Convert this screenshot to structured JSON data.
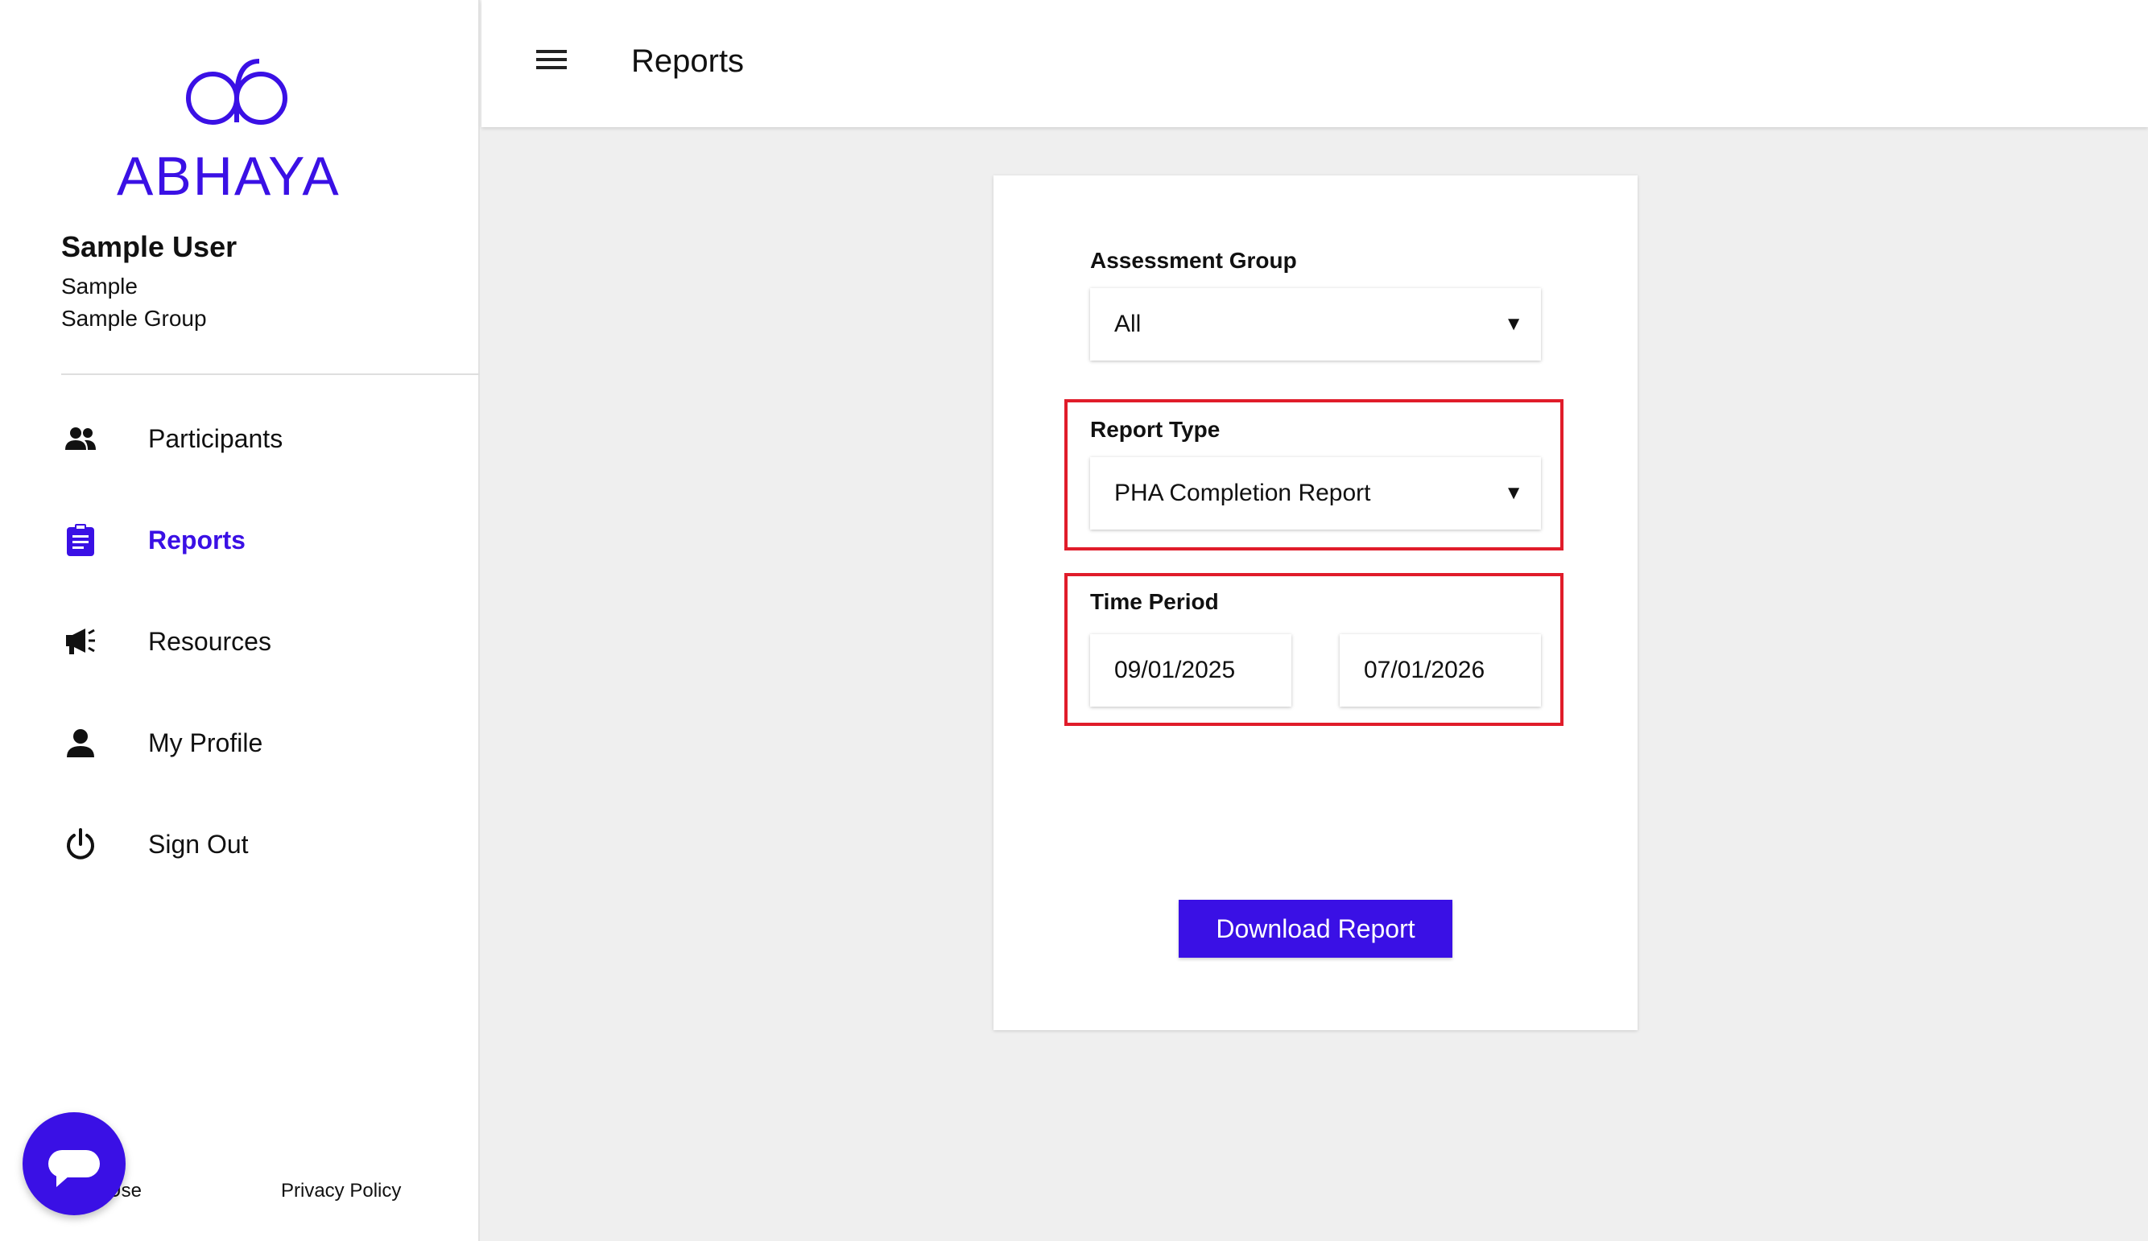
{
  "brand": {
    "name": "ABHAYA",
    "color": "#3a10e5"
  },
  "user": {
    "name": "Sample User",
    "org": "Sample",
    "group": "Sample Group"
  },
  "nav": {
    "items": [
      {
        "label": "Participants",
        "icon": "participants-icon",
        "active": false
      },
      {
        "label": "Reports",
        "icon": "clipboard-icon",
        "active": true
      },
      {
        "label": "Resources",
        "icon": "megaphone-icon",
        "active": false
      },
      {
        "label": "My Profile",
        "icon": "person-icon",
        "active": false
      },
      {
        "label": "Sign Out",
        "icon": "power-icon",
        "active": false
      }
    ]
  },
  "footer": {
    "terms": "s of Use",
    "privacy": "Privacy Policy"
  },
  "header": {
    "title": "Reports",
    "menu_icon": "hamburger-menu-icon"
  },
  "form": {
    "assessment_group": {
      "label": "Assessment Group",
      "value": "All"
    },
    "report_type": {
      "label": "Report Type",
      "value": "PHA Completion Report"
    },
    "time_period": {
      "label": "Time Period",
      "start": "09/01/2025",
      "end": "07/01/2026"
    },
    "download_label": "Download Report"
  },
  "chat": {
    "icon": "chat-bubble-icon"
  },
  "colors": {
    "accent": "#3a10e5",
    "highlight": "#e01c2a"
  }
}
